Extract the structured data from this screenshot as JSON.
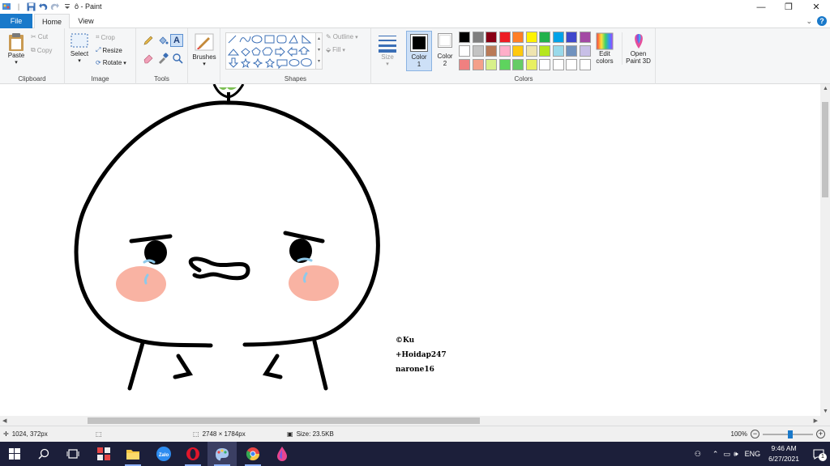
{
  "window": {
    "title": "ô - Paint"
  },
  "tabs": {
    "file": "File",
    "home": "Home",
    "view": "View"
  },
  "ribbon": {
    "clipboard": {
      "label": "Clipboard",
      "paste": "Paste",
      "cut": "Cut",
      "copy": "Copy"
    },
    "image": {
      "label": "Image",
      "select": "Select",
      "crop": "Crop",
      "resize": "Resize",
      "rotate": "Rotate"
    },
    "tools": {
      "label": "Tools"
    },
    "brushes": {
      "label": "Brushes"
    },
    "shapes": {
      "label": "Shapes",
      "outline": "Outline",
      "fill": "Fill"
    },
    "size": {
      "label": "Size"
    },
    "color1": {
      "label": "Color",
      "num": "1"
    },
    "color2": {
      "label": "Color",
      "num": "2"
    },
    "colors": {
      "label": "Colors",
      "edit": "Edit colors",
      "paint3d": "Open Paint 3D",
      "row1": [
        "#000000",
        "#7f7f7f",
        "#880015",
        "#ed1c24",
        "#ff7f27",
        "#fff200",
        "#22b14c",
        "#00a2e8",
        "#3f48cc",
        "#a349a4"
      ],
      "row2": [
        "#ffffff",
        "#c3c3c3",
        "#b97a57",
        "#ffaec9",
        "#ffc90e",
        "#efe4b0",
        "#b5e61d",
        "#99d9ea",
        "#7092be",
        "#c8bfe7"
      ],
      "row3": [
        "#f08080",
        "#f4a08a",
        "#d8f08a",
        "#5ed45e",
        "#66cc66",
        "#e8f060",
        "#ffffff",
        "#ffffff",
        "#ffffff",
        "#ffffff"
      ],
      "primary": "#000000",
      "secondary": "#ffffff"
    }
  },
  "canvas": {
    "credits": [
      "©Ku",
      "+Hoidap247",
      "narone16"
    ]
  },
  "statusbar": {
    "cursor_pos": "1024, 372px",
    "image_size": "2748 × 1784px",
    "file_size": "Size: 23.5KB",
    "zoom": "100%",
    "zoom_level": 0.55
  },
  "taskbar": {
    "lang": "ENG",
    "time": "9:46 AM",
    "date": "6/27/2021",
    "notif_count": "1",
    "apps": [
      "file-explorer-icon",
      "zalo-icon",
      "opera-icon",
      "paint-icon",
      "chrome-icon",
      "droplet-app-icon"
    ]
  }
}
